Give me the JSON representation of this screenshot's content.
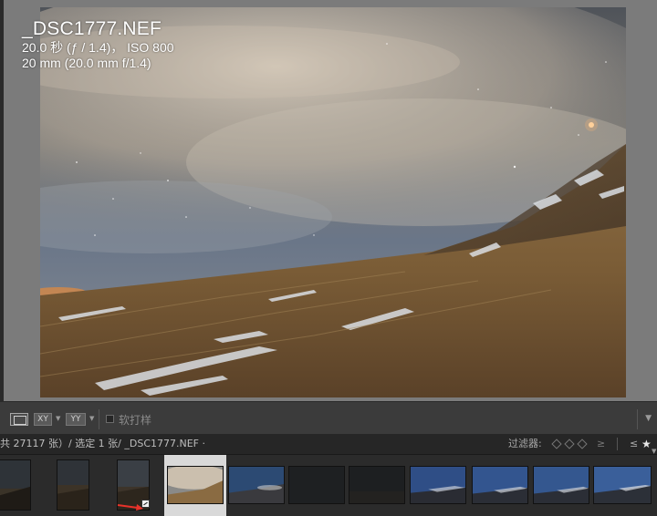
{
  "overlay": {
    "filename": "_DSC1777.NEF",
    "exposure": "20.0 秒 (ƒ / 1.4)， ISO 800",
    "lens": "20 mm (20.0 mm f/1.4)"
  },
  "toolbar": {
    "compare_label": "XY",
    "survey_label": "YY",
    "soft_proof_label": "软打样"
  },
  "filmstrip": {
    "info": "共 27117 张）/ 选定 1 张/ _DSC1777.NEF ·",
    "filter_label": "过滤器:",
    "rating_stars": "★",
    "rating_cmp": "≤",
    "rating_cmp2": "≥"
  },
  "colors": {
    "accent_arrow": "#e8322a",
    "selected_cell": "#d9d9d9",
    "panel_dark": "#262626"
  }
}
